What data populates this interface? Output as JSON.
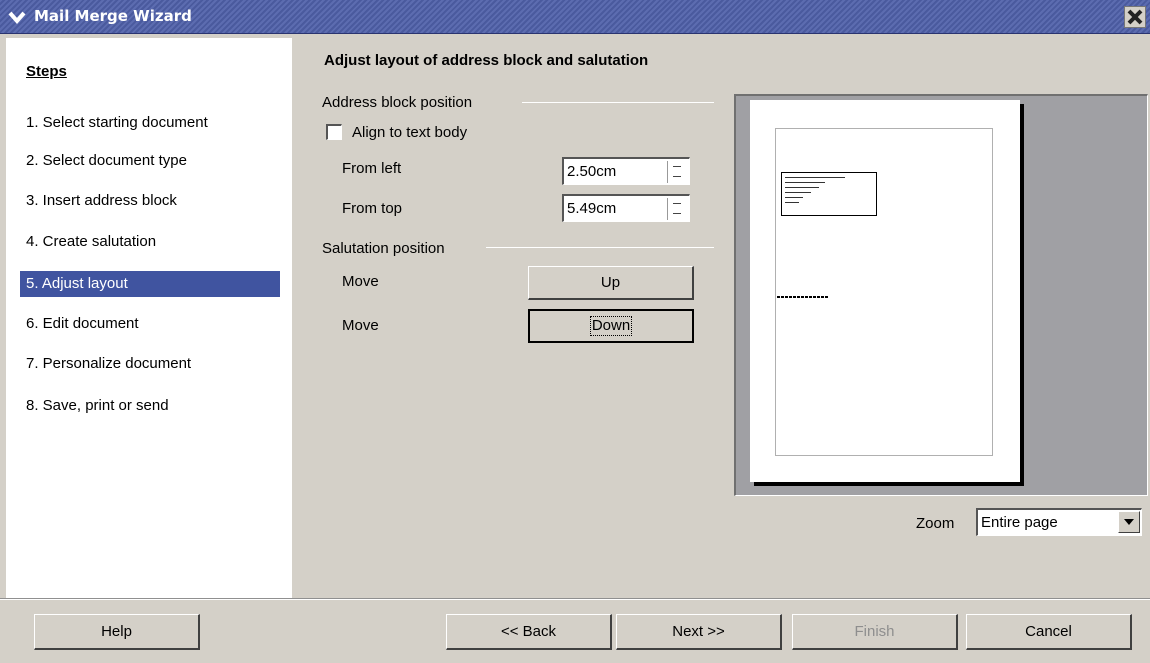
{
  "window": {
    "title": "Mail Merge Wizard"
  },
  "sidebar": {
    "title": "Steps",
    "items": [
      {
        "label": "1. Select starting document",
        "active": false
      },
      {
        "label": "2. Select document type",
        "active": false
      },
      {
        "label": "3. Insert address block",
        "active": false
      },
      {
        "label": "4. Create salutation",
        "active": false
      },
      {
        "label": "5. Adjust layout",
        "active": true
      },
      {
        "label": "6. Edit document",
        "active": false
      },
      {
        "label": "7. Personalize document",
        "active": false
      },
      {
        "label": "8. Save, print or send",
        "active": false
      }
    ]
  },
  "main": {
    "heading": "Adjust layout of address block and salutation",
    "address_group": {
      "label": "Address block position",
      "align_checkbox": {
        "label": "Align to text body",
        "checked": false
      },
      "from_left": {
        "label": "From left",
        "value": "2.50cm"
      },
      "from_top": {
        "label": "From top",
        "value": "5.49cm"
      }
    },
    "salutation_group": {
      "label": "Salutation position",
      "move_up_label": "Move",
      "move_down_label": "Move",
      "up_button": "Up",
      "down_button": "Down"
    },
    "zoom": {
      "label": "Zoom",
      "value": "Entire page"
    }
  },
  "footer": {
    "help": "Help",
    "back": "<< Back",
    "next": "Next >>",
    "finish": "Finish",
    "cancel": "Cancel"
  },
  "colors": {
    "title_bar": "#4f5fa5",
    "active_step": "#4054a0",
    "dialog_bg": "#d4d0c8"
  }
}
